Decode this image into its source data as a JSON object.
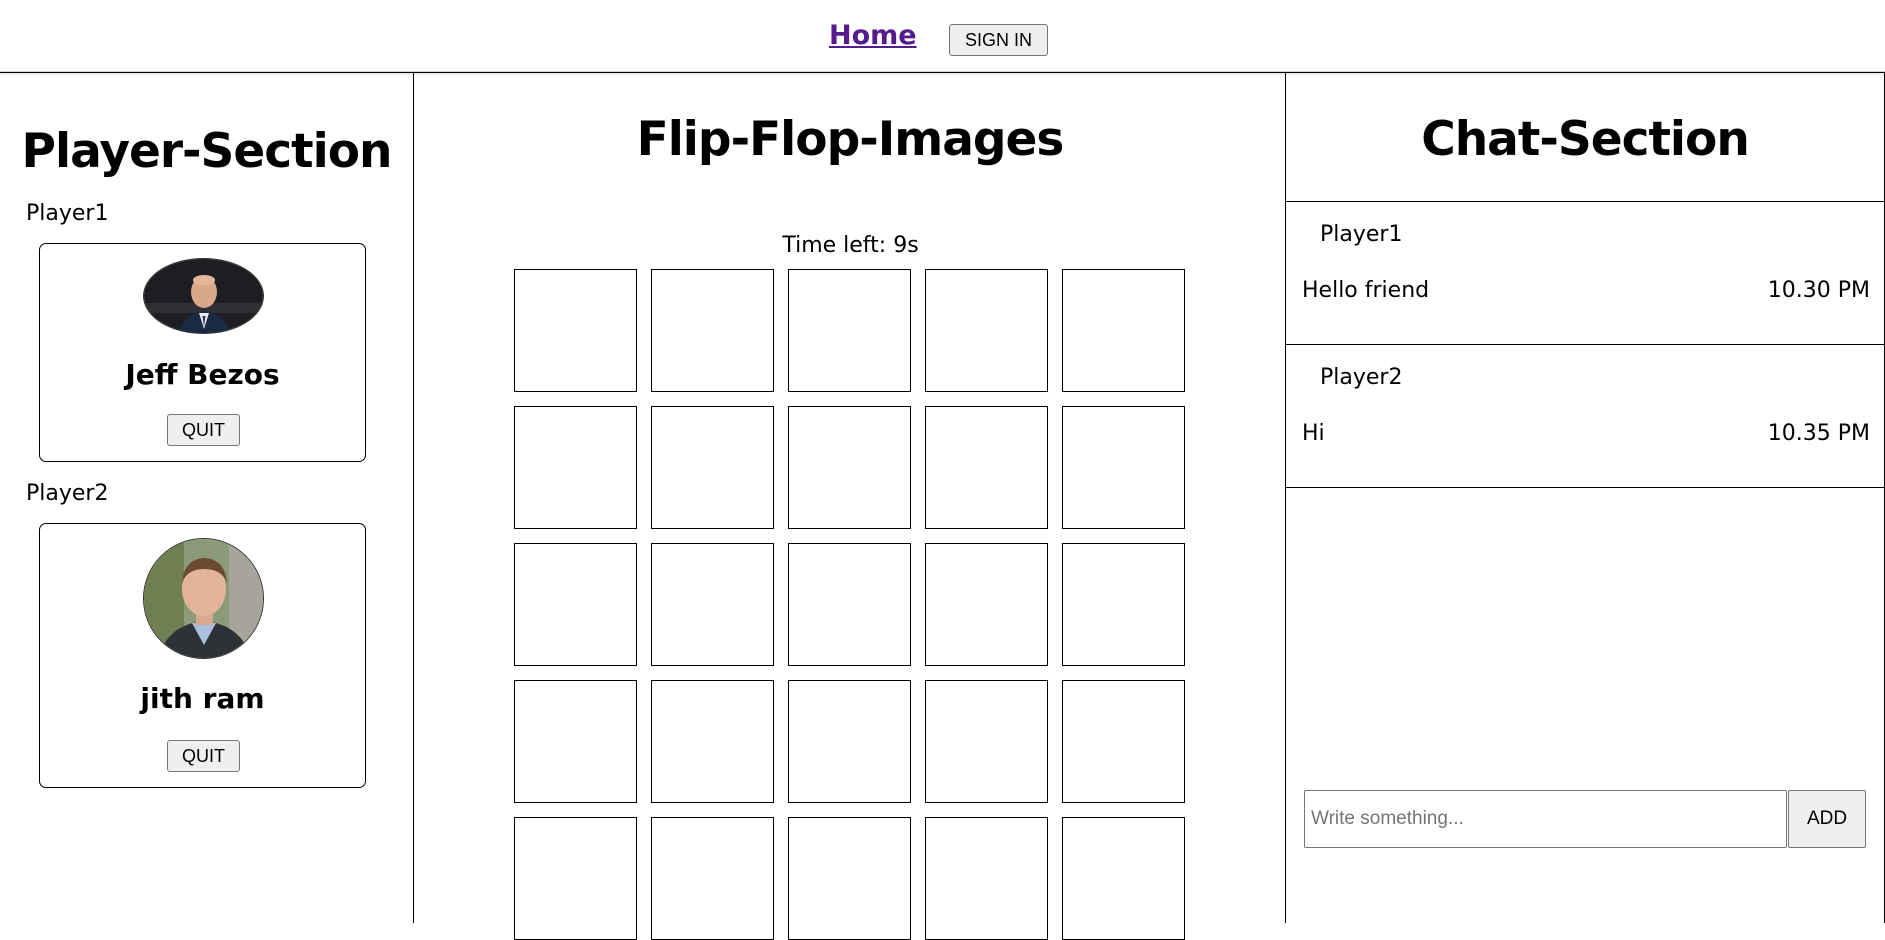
{
  "nav": {
    "home_label": "Home",
    "signin_label": "SIGN IN"
  },
  "players_section": {
    "title": "Player-Section",
    "players": [
      {
        "slot_label": "Player1",
        "name": "Jeff Bezos",
        "quit_label": "QUIT",
        "avatar_icon": "person-photo-icon"
      },
      {
        "slot_label": "Player2",
        "name": "jith ram",
        "quit_label": "QUIT",
        "avatar_icon": "person-photo-icon"
      }
    ]
  },
  "game": {
    "title": "Flip-Flop-Images",
    "timer_text": "Time left: 9s",
    "board": {
      "columns": 5,
      "visible_rows": 5,
      "tiles_face_down": true
    }
  },
  "chat": {
    "title": "Chat-Section",
    "messages": [
      {
        "sender": "Player1",
        "text": "Hello friend",
        "time": "10.30 PM"
      },
      {
        "sender": "Player2",
        "text": "Hi",
        "time": "10.35 PM"
      }
    ],
    "input_placeholder": "Write something...",
    "input_value": "",
    "add_label": "ADD"
  },
  "colors": {
    "link": "#551a8b",
    "border": "#000000",
    "button_bg": "#efefef"
  }
}
